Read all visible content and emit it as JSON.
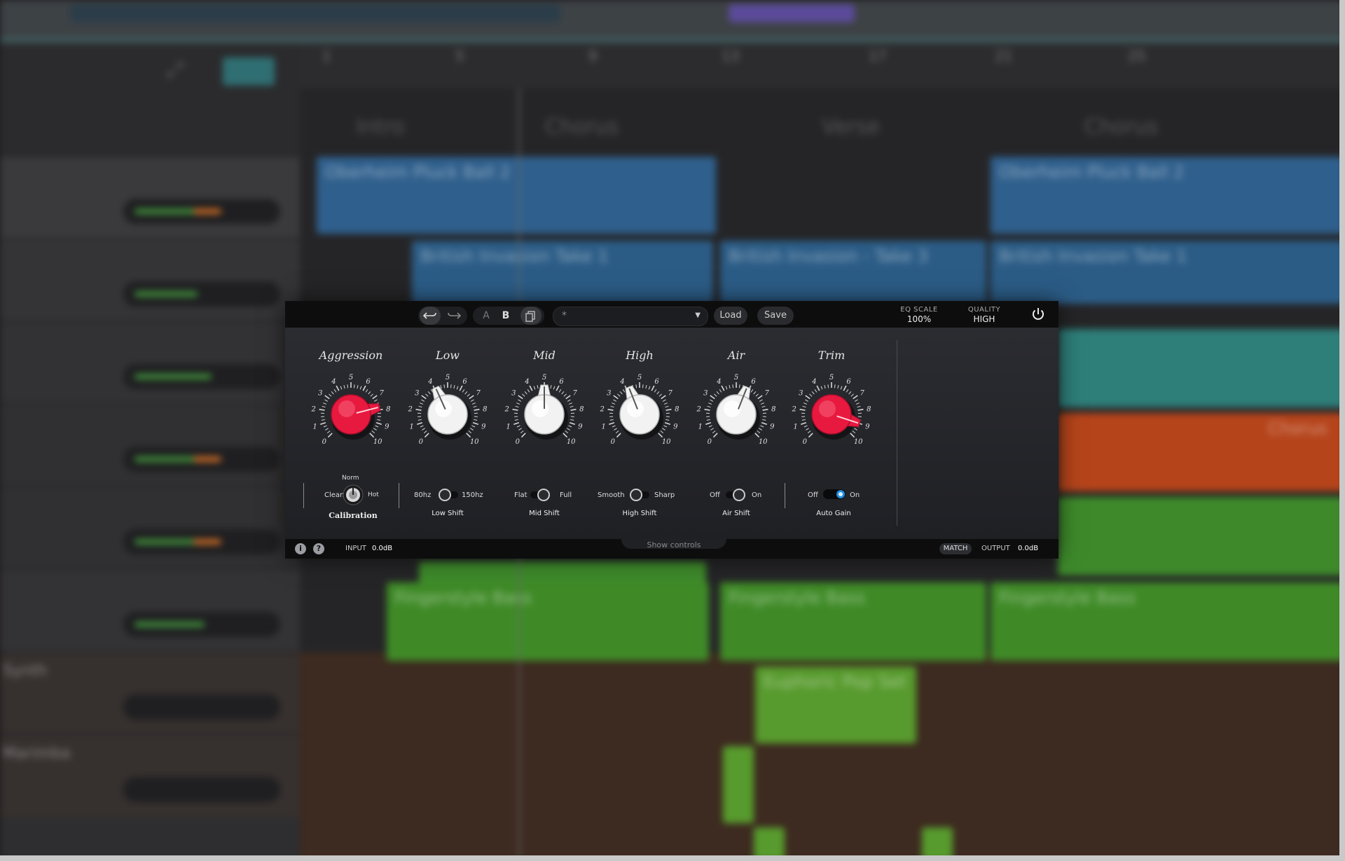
{
  "daw": {
    "ruler_marks": [
      "1",
      "5",
      "9",
      "13",
      "17",
      "21",
      "25"
    ],
    "sections": [
      "Intro",
      "Chorus",
      "Verse",
      "Chorus"
    ],
    "tracks": [
      "",
      "",
      "",
      "",
      "",
      "",
      "",
      "Synth",
      "Marimba"
    ],
    "clips": [
      "Oberheim Pluck Ball 2",
      "Oberheim Pluck Ball 2",
      "British Invasion Take 1",
      "British Invasion - Take 3",
      "British Invasion Take 1",
      "Fingerstyle Bass",
      "Fingerstyle Bass",
      "Fingerstyle Bass",
      "Euphoric Pop Set",
      "Chorus"
    ]
  },
  "plugin": {
    "toolbar": {
      "undo_icon": "undo-icon",
      "redo_icon": "redo-icon",
      "a_label": "A",
      "b_label": "B",
      "copy_icon": "copy-icon",
      "preset_value": "*",
      "load_label": "Load",
      "save_label": "Save",
      "eq_scale_label": "EQ SCALE",
      "eq_scale_value": "100%",
      "quality_label": "QUALITY",
      "quality_value": "HIGH",
      "power_icon": "power-icon"
    },
    "knob_scale": [
      "0",
      "1",
      "2",
      "3",
      "4",
      "5",
      "6",
      "7",
      "8",
      "9",
      "10"
    ],
    "knobs": [
      {
        "title": "Aggression",
        "value": 7.8,
        "color": "red"
      },
      {
        "title": "Low",
        "value": 4.1,
        "color": "white"
      },
      {
        "title": "Mid",
        "value": 5.0,
        "color": "white"
      },
      {
        "title": "High",
        "value": 4.2,
        "color": "white"
      },
      {
        "title": "Air",
        "value": 5.8,
        "color": "white"
      },
      {
        "title": "Trim",
        "value": 9.0,
        "color": "red"
      }
    ],
    "calibration": {
      "clean": "Clean",
      "norm": "Norm",
      "hot": "Hot",
      "label": "Calibration"
    },
    "switches": [
      {
        "left": "80hz",
        "right": "150hz",
        "label": "Low Shift"
      },
      {
        "left": "Flat",
        "right": "Full",
        "label": "Mid Shift"
      },
      {
        "left": "Smooth",
        "right": "Sharp",
        "label": "High Shift"
      },
      {
        "left": "Off",
        "right": "On",
        "label": "Air Shift"
      }
    ],
    "auto_gain": {
      "left": "Off",
      "right": "On",
      "label": "Auto Gain",
      "state": "On"
    },
    "footer": {
      "info_icon": "info-icon",
      "help_icon": "help-icon",
      "input_label": "INPUT",
      "input_value": "0.0dB",
      "show_controls": "Show controls",
      "match_label": "MATCH",
      "output_label": "OUTPUT",
      "output_value": "0.0dB"
    }
  }
}
